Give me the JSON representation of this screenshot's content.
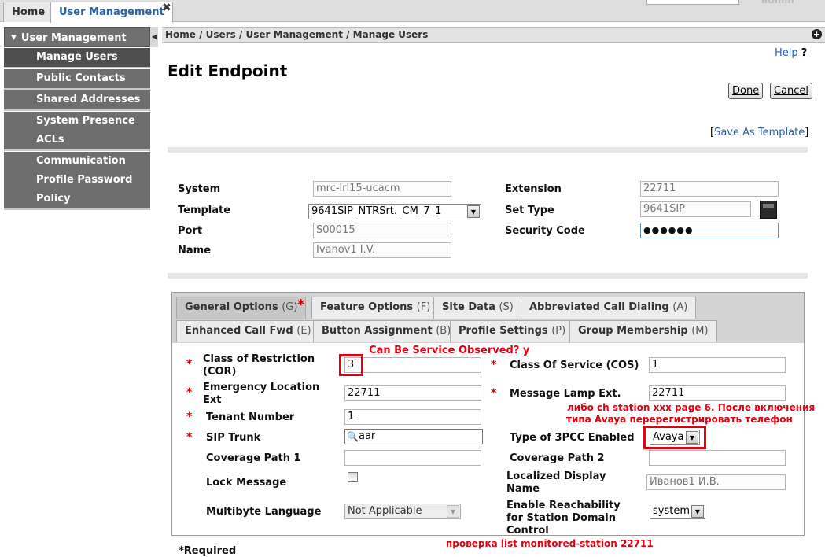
{
  "top_tabs": {
    "home": "Home",
    "user_management": "User Management",
    "close": "✖"
  },
  "top_user": "admin",
  "nav": {
    "header": "User Management",
    "items": [
      "Manage Users",
      "Public Contacts",
      "Shared Addresses",
      "System Presence",
      "ACLs",
      "Communication",
      "Profile Password",
      "Policy"
    ]
  },
  "breadcrumb": "Home / Users / User Management / Manage Users",
  "help": {
    "label": "Help",
    "mark": "?"
  },
  "page_title": "Edit Endpoint",
  "buttons": {
    "done": "Done",
    "cancel": "Cancel"
  },
  "save_as_template": {
    "open": "[",
    "label": "Save As Template",
    "close": "]"
  },
  "endpoint": {
    "system_label": "System",
    "system_value": "mrc-lrl15-ucacm",
    "template_label": "Template",
    "template_value": "9641SIP_NTRSrt._CM_7_1",
    "port_label": "Port",
    "port_value": "S00015",
    "name_label": "Name",
    "name_value": "Ivanov1 I.V.",
    "extension_label": "Extension",
    "extension_value": "22711",
    "settype_label": "Set Type",
    "settype_value": "9641SIP",
    "seccode_label": "Security Code",
    "seccode_value": "●●●●●●"
  },
  "tabs": [
    {
      "label": "General Options",
      "key": "(G)"
    },
    {
      "label": "Feature Options",
      "key": "(F)"
    },
    {
      "label": "Site Data",
      "key": "(S)"
    },
    {
      "label": "Abbreviated Call Dialing",
      "key": "(A)"
    },
    {
      "label": "Enhanced Call Fwd",
      "key": "(E)"
    },
    {
      "label": "Button Assignment",
      "key": "(B)"
    },
    {
      "label": "Profile Settings",
      "key": "(P)"
    },
    {
      "label": "Group Membership",
      "key": "(M)"
    }
  ],
  "required_mark": "*",
  "general": {
    "cor_label": "Class of Restriction (COR)",
    "cor_value": "3",
    "cos_label": "Class Of Service (COS)",
    "cos_value": "1",
    "emerg_label": "Emergency Location Ext",
    "emerg_value": "22711",
    "mle_label": "Message Lamp Ext.",
    "mle_value": "22711",
    "tenant_label": "Tenant Number",
    "tenant_value": "1",
    "sip_label": "SIP Trunk",
    "sip_value": "aar",
    "pcc_label": "Type of 3PCC Enabled",
    "pcc_value": "Avaya",
    "cov1_label": "Coverage Path 1",
    "cov1_value": "",
    "cov2_label": "Coverage Path 2",
    "cov2_value": "",
    "lock_label": "Lock Message",
    "ldn_label": "Localized Display Name",
    "ldn_value": "Иванов1 И.В.",
    "mbl_label": "Multibyte Language",
    "mbl_value": "Not Applicable",
    "reach_label": "Enable Reachability for Station Domain Control",
    "reach_value": "system"
  },
  "footer_required": "*Required",
  "annotations": {
    "service_observed": "Can Be Service Observed? y",
    "ch_station_line1": "либо ch station xxx page 6. После включения",
    "ch_station_line2": "типа Avaya перерегистрировать телефон",
    "monitored": "проверка list monitored-station 22711"
  },
  "colors": {
    "annotation": "#e0000f",
    "link": "#2b5fb5",
    "nav_bg": "#6e6e6e",
    "required": "#d40000"
  }
}
